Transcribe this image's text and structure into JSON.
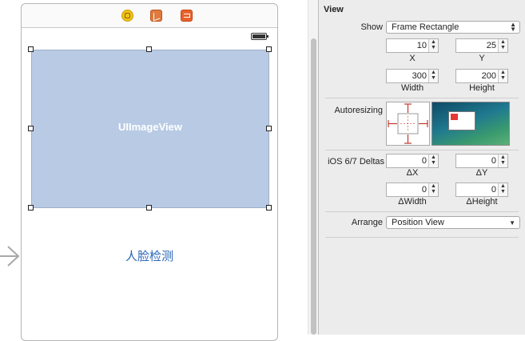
{
  "canvas": {
    "image_view_label": "UIImageView",
    "face_button_label": "人脸检测",
    "dock_icons": [
      "view-controller-icon",
      "first-responder-icon",
      "exit-icon"
    ],
    "battery_icon": "battery-icon"
  },
  "inspector": {
    "section_title": "View",
    "show_label": "Show",
    "show_value": "Frame Rectangle",
    "frame": {
      "x": "10",
      "x_label": "X",
      "y": "25",
      "y_label": "Y",
      "width": "300",
      "width_label": "Width",
      "height": "200",
      "height_label": "Height"
    },
    "autoresizing_label": "Autoresizing",
    "deltas": {
      "label": "iOS 6/7 Deltas",
      "dx": "0",
      "dx_label": "ΔX",
      "dy": "0",
      "dy_label": "ΔY",
      "dwidth": "0",
      "dwidth_label": "ΔWidth",
      "dheight": "0",
      "dheight_label": "ΔHeight"
    },
    "arrange_label": "Arrange",
    "arrange_value": "Position View"
  },
  "colors": {
    "image_view_bg": "#b8cae4",
    "button_text": "#2a66b9",
    "strut_red": "#c0392b",
    "inspector_bg": "#ececec"
  }
}
